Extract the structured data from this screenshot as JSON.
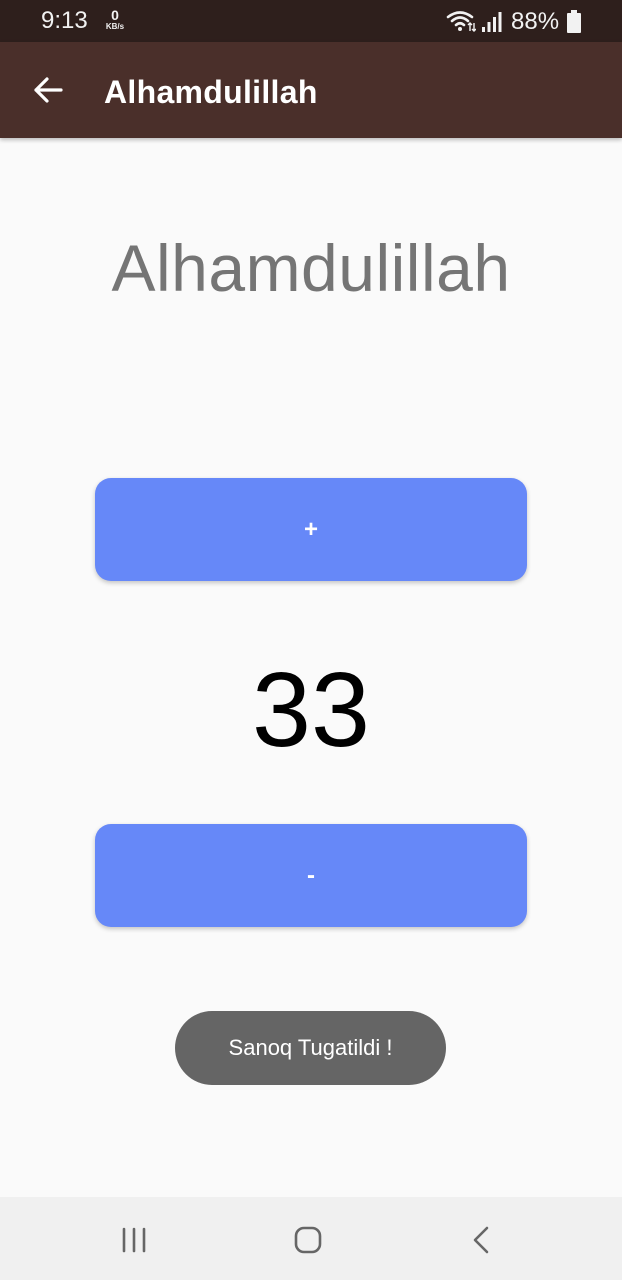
{
  "status_bar": {
    "time": "9:13",
    "net_speed_value": "0",
    "net_speed_unit": "KB/s",
    "battery": "88%",
    "icons": [
      "wifi-icon",
      "signal-icon",
      "battery-icon"
    ]
  },
  "app_bar": {
    "back_icon": "arrow-left-icon",
    "title": "Alhamdulillah",
    "background_color": "#4a2f2a"
  },
  "content": {
    "title": "Alhamdulillah",
    "increment_label": "+",
    "count": "33",
    "decrement_label": "-",
    "button_color": "#6688f8"
  },
  "toast": {
    "message": "Sanoq Tugatildi !"
  },
  "nav_bar": {
    "icons": [
      "recents-icon",
      "home-icon",
      "back-icon"
    ]
  }
}
